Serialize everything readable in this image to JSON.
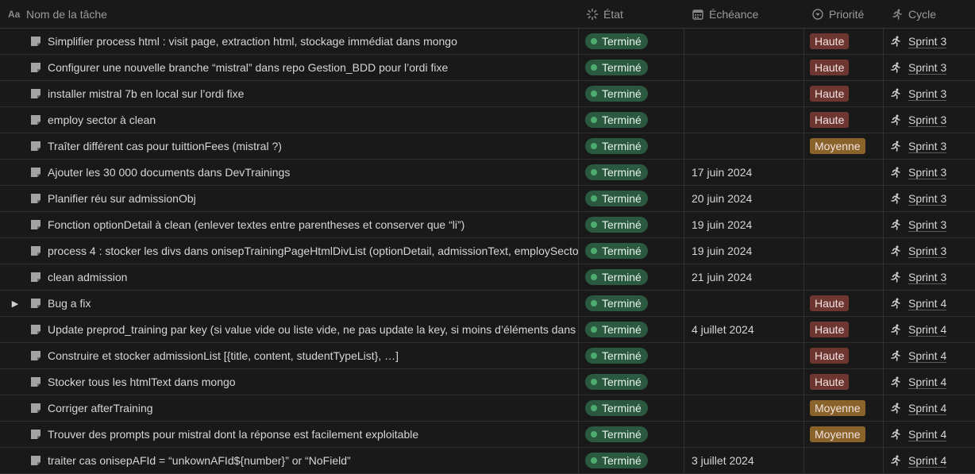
{
  "columns": {
    "name": "Nom de la tâche",
    "etat": "État",
    "echeance": "Échéance",
    "priorite": "Priorité",
    "cycle": "Cycle"
  },
  "colors": {
    "status_bg": "#2b593f",
    "status_dot": "#4dab6f",
    "haute_bg": "#6e3630",
    "moyenne_bg": "#89632a"
  },
  "rows": [
    {
      "name": "Simplifier process html : visit page, extraction html, stockage immédiat dans mongo",
      "etat": "Terminé",
      "echeance": "",
      "priorite": "Haute",
      "cycle": "Sprint 3",
      "toggle": ""
    },
    {
      "name": "Configurer une nouvelle branche “mistral” dans repo Gestion_BDD pour l’ordi fixe",
      "etat": "Terminé",
      "echeance": "",
      "priorite": "Haute",
      "cycle": "Sprint 3",
      "toggle": ""
    },
    {
      "name": "installer mistral 7b en local sur l’ordi fixe",
      "etat": "Terminé",
      "echeance": "",
      "priorite": "Haute",
      "cycle": "Sprint 3",
      "toggle": ""
    },
    {
      "name": "employ sector à clean",
      "etat": "Terminé",
      "echeance": "",
      "priorite": "Haute",
      "cycle": "Sprint 3",
      "toggle": ""
    },
    {
      "name": "Traîter différent cas pour tuittionFees (mistral ?)",
      "etat": "Terminé",
      "echeance": "",
      "priorite": "Moyenne",
      "cycle": "Sprint 3",
      "toggle": ""
    },
    {
      "name": "Ajouter les 30 000 documents dans DevTrainings",
      "etat": "Terminé",
      "echeance": "17 juin 2024",
      "priorite": "",
      "cycle": "Sprint 3",
      "toggle": ""
    },
    {
      "name": "Planifier réu sur admissionObj",
      "etat": "Terminé",
      "echeance": "20 juin 2024",
      "priorite": "",
      "cycle": "Sprint 3",
      "toggle": ""
    },
    {
      "name": "Fonction optionDetail à clean (enlever textes entre parentheses et conserver que “li”)",
      "etat": "Terminé",
      "echeance": "19 juin 2024",
      "priorite": "",
      "cycle": "Sprint 3",
      "toggle": ""
    },
    {
      "name": "process 4 : stocker les divs dans onisepTrainingPageHtmlDivList (optionDetail, admissionText, employSecto",
      "etat": "Terminé",
      "echeance": "19 juin 2024",
      "priorite": "",
      "cycle": "Sprint 3",
      "toggle": ""
    },
    {
      "name": "clean admission",
      "etat": "Terminé",
      "echeance": "21 juin 2024",
      "priorite": "",
      "cycle": "Sprint 3",
      "toggle": ""
    },
    {
      "name": "Bug a fix",
      "etat": "Terminé",
      "echeance": "",
      "priorite": "Haute",
      "cycle": "Sprint 4",
      "toggle": "▶"
    },
    {
      "name": "Update preprod_training par key (si value vide ou liste vide, ne pas update la key, si moins d’éléments dans",
      "etat": "Terminé",
      "echeance": "4 juillet 2024",
      "priorite": "Haute",
      "cycle": "Sprint 4",
      "toggle": ""
    },
    {
      "name": "Construire et stocker admissionList [{title, content, studentTypeList}, …]",
      "etat": "Terminé",
      "echeance": "",
      "priorite": "Haute",
      "cycle": "Sprint 4",
      "toggle": ""
    },
    {
      "name": "Stocker tous les htmlText dans mongo",
      "etat": "Terminé",
      "echeance": "",
      "priorite": "Haute",
      "cycle": "Sprint 4",
      "toggle": ""
    },
    {
      "name": "Corriger afterTraining",
      "etat": "Terminé",
      "echeance": "",
      "priorite": "Moyenne",
      "cycle": "Sprint 4",
      "toggle": ""
    },
    {
      "name": "Trouver des prompts pour mistral dont la réponse est facilement exploitable",
      "etat": "Terminé",
      "echeance": "",
      "priorite": "Moyenne",
      "cycle": "Sprint 4",
      "toggle": ""
    },
    {
      "name": "traiter cas onisepAFId = “unkownAFId${number}” or “NoField”",
      "etat": "Terminé",
      "echeance": "3 juillet 2024",
      "priorite": "",
      "cycle": "Sprint 4",
      "toggle": ""
    }
  ]
}
